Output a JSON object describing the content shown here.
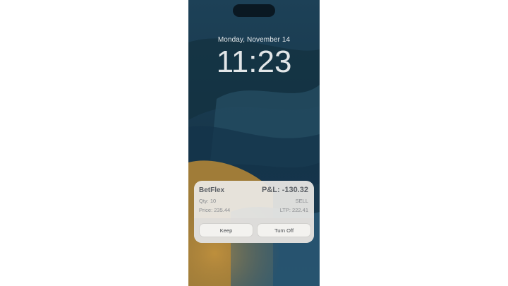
{
  "lock_screen": {
    "date": "Monday, November 14",
    "time": "11:23"
  },
  "notification": {
    "app_name": "BetFlex",
    "pnl": "P&L: -130.32",
    "qty": "Qty: 10",
    "side": "SELL",
    "price": "Price: 235.44",
    "ltp": "LTP: 222.41",
    "actions": {
      "keep_label": "Keep",
      "turn_off_label": "Turn Off"
    }
  },
  "colors": {
    "wallpaper_base": "#1b3b52",
    "wallpaper_accent": "#c8923a",
    "card_background": "#eceae6"
  }
}
